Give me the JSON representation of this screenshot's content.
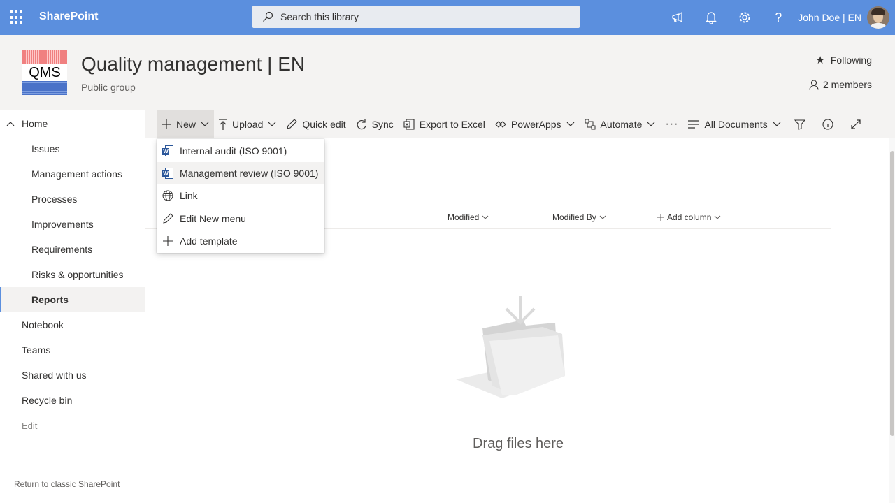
{
  "suite": {
    "brand": "SharePoint",
    "search_placeholder": "Search this library",
    "user_name": "John Doe | EN",
    "icons": [
      "megaphone-icon",
      "bell-icon",
      "gear-icon",
      "help-icon"
    ]
  },
  "site": {
    "logo_text": "QMS",
    "title": "Quality management | EN",
    "subtitle": "Public group",
    "following_label": "Following",
    "members_label": "2 members"
  },
  "nav": {
    "home": "Home",
    "items": [
      "Issues",
      "Management actions",
      "Processes",
      "Improvements",
      "Requirements",
      "Risks & opportunities",
      "Reports"
    ],
    "selected": "Reports",
    "notebook": "Notebook",
    "teams": "Teams",
    "shared": "Shared with us",
    "recycle": "Recycle bin",
    "edit": "Edit",
    "classic_link": "Return to classic SharePoint"
  },
  "commands": {
    "new": "New",
    "upload": "Upload",
    "quick_edit": "Quick edit",
    "sync": "Sync",
    "export": "Export to Excel",
    "powerapps": "PowerApps",
    "automate": "Automate",
    "more": "···",
    "view": "All Documents"
  },
  "new_menu": {
    "items": [
      "Internal audit (ISO 9001)",
      "Management review (ISO 9001)",
      "Link",
      "Edit New menu",
      "Add template"
    ],
    "hovered": "Management review (ISO 9001)"
  },
  "columns": {
    "modified": "Modified",
    "modified_by": "Modified By",
    "add_column": "Add column"
  },
  "empty_state": {
    "text": "Drag files here"
  },
  "colors": {
    "suite_bar": "#5b8fde",
    "header_bg": "#f4f3f2",
    "word_blue": "#2b579a"
  }
}
